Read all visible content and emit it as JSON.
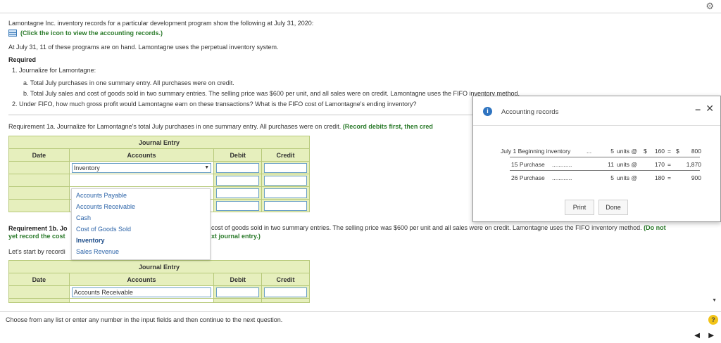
{
  "header": {
    "settings_icon": "gear-icon"
  },
  "question": {
    "intro": "Lamontagne Inc. inventory records for a particular development program show the following at July 31, 2020:",
    "records_link": "(Click the icon to view the accounting records.)",
    "on_hand": "At July 31, 11 of these programs are on hand. Lamontagne uses the perpetual inventory system.",
    "required_label": "Required",
    "req1": "1. Journalize for Lamontagne:",
    "req1a": "a.   Total July purchases in one summary entry. All purchases were on credit.",
    "req1b": "b.   Total July sales and cost of goods sold in two summary entries. The selling price was $600 per unit, and all sales were on credit. Lamontagne uses the FIFO inventory method.",
    "req2": "2. Under FIFO, how much gross profit would Lamontagne earn on these transactions? What is the FIFO cost of Lamontagne's ending inventory?"
  },
  "req1a_section": {
    "text": "Requirement 1a. Journalize for Lamontagne's total July purchases in one summary entry. All purchases were on credit.",
    "instruction": "(Record debits first, then cred"
  },
  "journal1": {
    "title": "Journal Entry",
    "headers": [
      "Date",
      "Accounts",
      "Debit",
      "Credit"
    ],
    "selected_account": "Inventory"
  },
  "dropdown": {
    "options": [
      "Accounts Payable",
      "Accounts Receivable",
      "Cash",
      "Cost of Goods Sold",
      "Inventory",
      "Sales Revenue"
    ],
    "highlighted": "Inventory"
  },
  "req1b_section": {
    "label": "Requirement 1b. Jo",
    "text_right": "cost of goods sold in two summary entries. The selling price was $600 per unit and all sales were on credit. Lamontagne uses the FIFO inventory method.",
    "do_not": "(Do not",
    "line2_left": "yet record the cost",
    "line2_right": "xt journal entry.)",
    "start": "Let's start by recordi"
  },
  "journal2": {
    "title": "Journal Entry",
    "headers": [
      "Date",
      "Accounts",
      "Debit",
      "Credit"
    ],
    "first_account": "Accounts Receivable"
  },
  "popup": {
    "title": "Accounting records",
    "records": [
      {
        "label": "July 1 Beginning inventory",
        "dots": "...",
        "units": "5",
        "unit_word": "units @",
        "cur": "$",
        "price": "160",
        "eq": "=",
        "cur2": "$",
        "total": "800"
      },
      {
        "label": "15 Purchase",
        "dots": "............",
        "units": "11",
        "unit_word": "units @",
        "cur": "",
        "price": "170",
        "eq": "=",
        "cur2": "",
        "total": "1,870"
      },
      {
        "label": "26 Purchase",
        "dots": "............",
        "units": "5",
        "unit_word": "units @",
        "cur": "",
        "price": "180",
        "eq": "=",
        "cur2": "",
        "total": "900"
      }
    ],
    "print_label": "Print",
    "done_label": "Done"
  },
  "footer": {
    "instruction": "Choose from any list or enter any number in the input fields and then continue to the next question.",
    "help": "?"
  }
}
